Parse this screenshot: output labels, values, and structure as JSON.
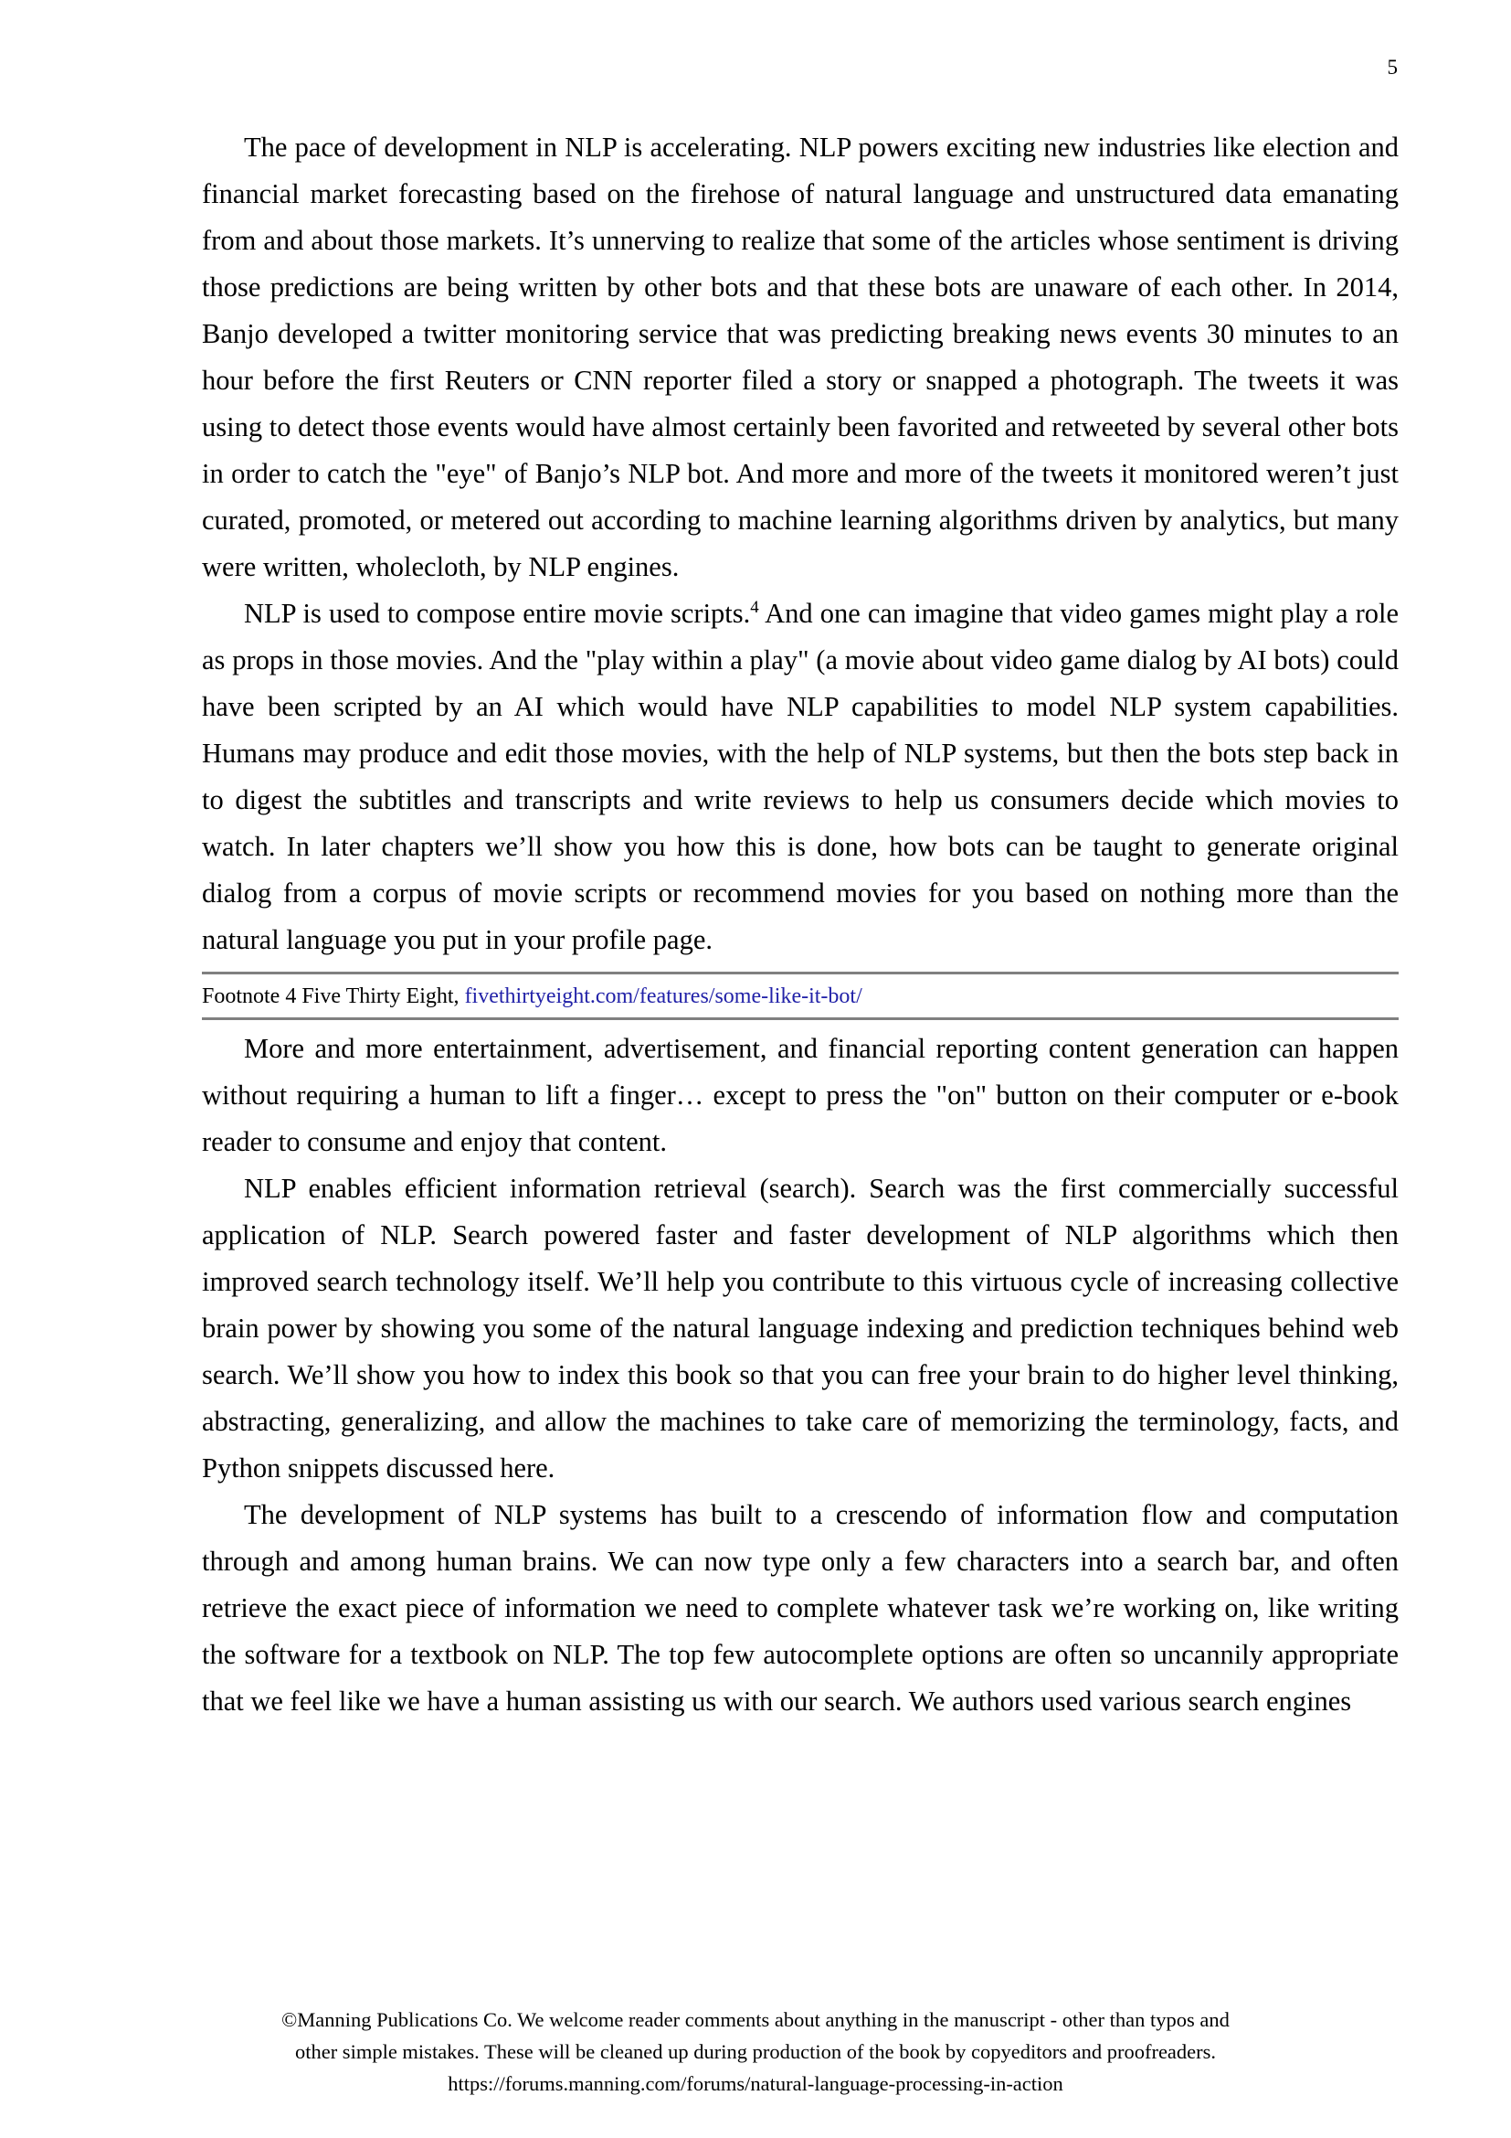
{
  "page": {
    "number": "5",
    "link_color": "#2222a8",
    "rule_color": "#808080",
    "text_color": "#000000",
    "background_color": "#ffffff"
  },
  "body": {
    "paragraphs": [
      {
        "id": "para-nlp-pace",
        "text_before_ref": "The pace of development in NLP is accelerating. NLP powers exciting new industries like election and financial market forecasting based on the firehose of natural language and unstructured data emanating from and about those markets. It’s unnerving to realize that some of the articles whose sentiment is driving those predictions are being written by other bots and that these bots are unaware of each other. In 2014, Banjo developed a twitter monitoring service that was predicting breaking news events 30 minutes to an hour before the first Reuters or CNN reporter filed a story or snapped a photograph. The tweets it was using to detect those events would have almost certainly been favorited and retweeted by several other bots in order to catch the \"eye\" of Banjo’s NLP bot. And more and more of the tweets it monitored weren’t just curated, promoted, or metered out according to machine learning algorithms driven by analytics, but many were written, wholecloth, by NLP engines.",
        "footnote_ref": "",
        "text_after_ref": ""
      },
      {
        "id": "para-movie-scripts",
        "text_before_ref": "NLP is used to compose entire movie scripts.",
        "footnote_ref": "4",
        "text_after_ref": " And one can imagine that video games might play a role as props in those movies. And the \"play within a play\" (a movie about video game dialog by AI bots) could have been scripted by an AI which would have NLP capabilities to model NLP system capabilities. Humans may produce and edit those movies, with the help of NLP systems, but then the bots step back in to digest the subtitles and transcripts and write reviews to help us consumers decide which movies to watch. In later chapters we’ll show you how this is done, how bots can be taught to generate original dialog from a corpus of movie scripts or recommend movies for you based on nothing more than the natural language you put in your profile page."
      },
      {
        "id": "para-entertainment",
        "text_before_ref": "More and more entertainment, advertisement, and financial reporting content generation can happen without requiring a human to lift a finger… except to press the \"on\" button on their computer or e-book reader to consume and enjoy that content.",
        "footnote_ref": "",
        "text_after_ref": ""
      },
      {
        "id": "para-information-retrieval",
        "text_before_ref": "NLP enables efficient information retrieval (search). Search was the first commercially successful application of NLP. Search powered faster and faster development of NLP algorithms which then improved search technology itself. We’ll help you contribute to this virtuous cycle of increasing collective brain power by showing you some of the natural language indexing and prediction techniques behind web search. We’ll show you how to index this book so that you can free your brain to do higher level thinking, abstracting, generalizing, and allow the machines to take care of memorizing the terminology, facts, and Python snippets discussed here.",
        "footnote_ref": "",
        "text_after_ref": ""
      },
      {
        "id": "para-crescendo",
        "text_before_ref": "The development of NLP systems has built to a crescendo of information flow and computation through and among human brains. We can now type only a few characters into a search bar, and often retrieve the exact piece of information we need to complete whatever task we’re working on, like writing the software for a textbook on NLP. The top few autocomplete options are often so uncannily appropriate that we feel like we have a human assisting us with our search. We authors used various search engines",
        "footnote_ref": "",
        "text_after_ref": ""
      }
    ]
  },
  "footnote": {
    "label": "Footnote 4   Five Thirty Eight, ",
    "link_text": "fivethirtyeight.com/features/some-like-it-bot/"
  },
  "footer": {
    "lines": [
      "©Manning Publications Co. We welcome reader comments about anything in the manuscript - other than typos and",
      "other simple mistakes. These will be cleaned up during production of the book by copyeditors and proofreaders.",
      "https://forums.manning.com/forums/natural-language-processing-in-action"
    ]
  }
}
